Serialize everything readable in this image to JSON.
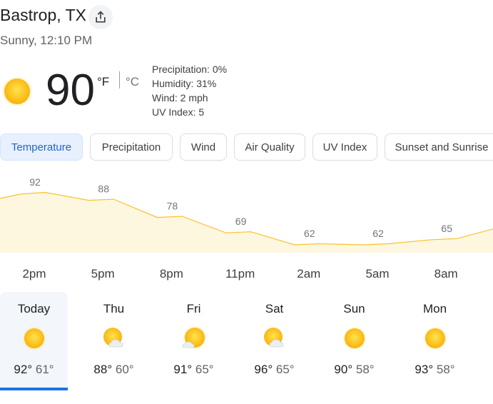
{
  "header": {
    "location": "Bastrop, TX",
    "condition": "Sunny, 12:10 PM",
    "share_icon": "share-icon"
  },
  "current": {
    "temperature": "90",
    "unit_f": "°F",
    "unit_c": "°C",
    "icon": "sun-icon",
    "precipitation": "Precipitation: 0%",
    "humidity": "Humidity: 31%",
    "wind": "Wind: 2 mph",
    "uv_index": "UV Index: 5"
  },
  "tabs": [
    {
      "label": "Temperature",
      "active": true
    },
    {
      "label": "Precipitation"
    },
    {
      "label": "Wind"
    },
    {
      "label": "Air Quality"
    },
    {
      "label": "UV Index"
    },
    {
      "label": "Sunset and Sunrise"
    }
  ],
  "chart_data": {
    "type": "area",
    "x": [
      "2pm",
      "5pm",
      "8pm",
      "11pm",
      "2am",
      "5am",
      "8am"
    ],
    "values": [
      92,
      88,
      78,
      69,
      62,
      62,
      65
    ],
    "fill_color": "#fef7e0",
    "line_color": "#fbc02d"
  },
  "forecast": [
    {
      "day": "Today",
      "high": "92°",
      "low": "61°",
      "icon": "sun-icon"
    },
    {
      "day": "Thu",
      "high": "88°",
      "low": "60°",
      "icon": "partly-cloudy-icon"
    },
    {
      "day": "Fri",
      "high": "91°",
      "low": "65°",
      "icon": "mostly-sunny-icon"
    },
    {
      "day": "Sat",
      "high": "96°",
      "low": "65°",
      "icon": "partly-cloudy-icon"
    },
    {
      "day": "Sun",
      "high": "90°",
      "low": "58°",
      "icon": "sun-icon"
    },
    {
      "day": "Mon",
      "high": "93°",
      "low": "58°",
      "icon": "sun-icon"
    }
  ]
}
